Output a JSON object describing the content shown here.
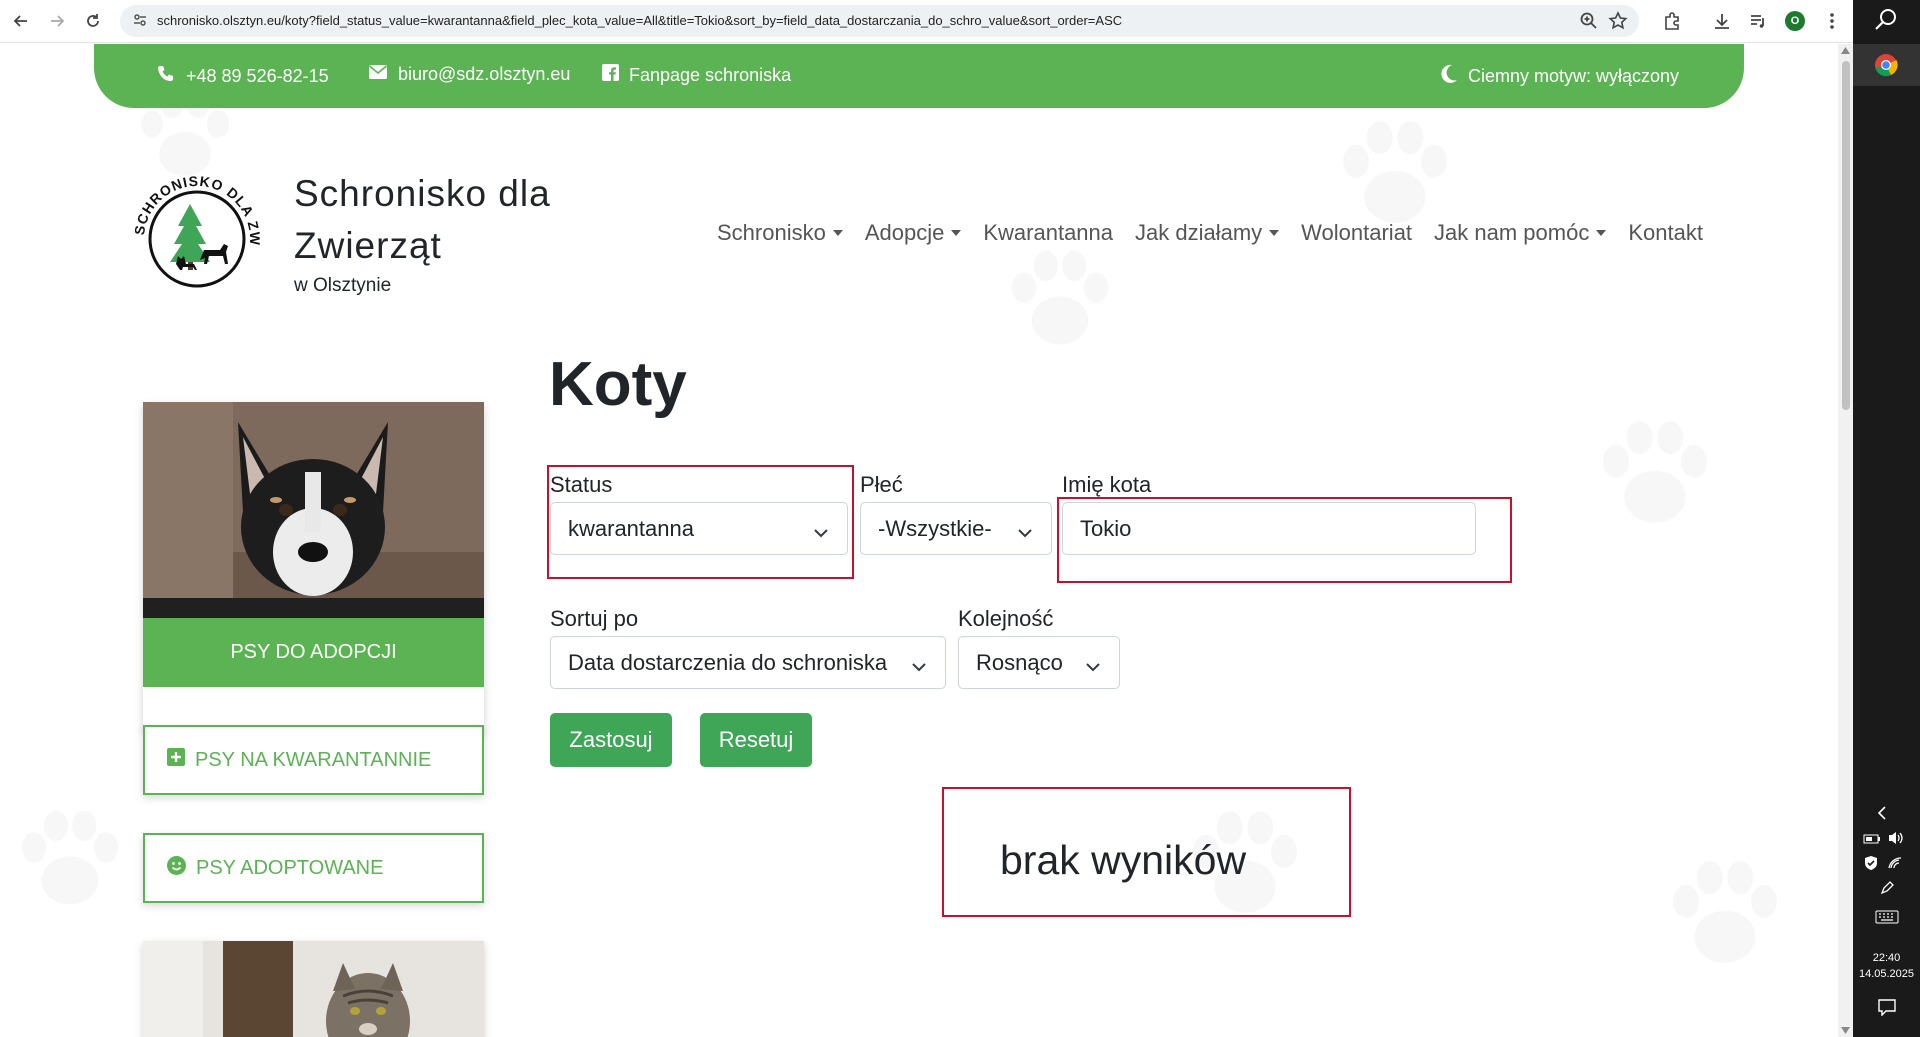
{
  "browser": {
    "url": "schronisko.olsztyn.eu/koty?field_status_value=kwarantanna&field_plec_kota_value=All&title=Tokio&sort_by=field_data_dostarczania_do_schro_value&sort_order=ASC",
    "profile_initial": "O"
  },
  "topbar": {
    "phone": "+48 89 526-82-15",
    "email": "biuro@sdz.olsztyn.eu",
    "fanpage": "Fanpage schroniska",
    "theme": "Ciemny motyw: wyłączony"
  },
  "header": {
    "title_line1": "Schronisko dla",
    "title_line2": "Zwierząt",
    "subtitle": "w Olsztynie",
    "logo_text": "SCHRONISKO DLA ZWIERZĄT W OLSZTYNIE"
  },
  "nav": [
    {
      "label": "Schronisko",
      "dropdown": true
    },
    {
      "label": "Adopcje",
      "dropdown": true
    },
    {
      "label": "Kwarantanna",
      "dropdown": false
    },
    {
      "label": "Jak działamy",
      "dropdown": true
    },
    {
      "label": "Wolontariat",
      "dropdown": false
    },
    {
      "label": "Jak nam pomóc",
      "dropdown": true
    },
    {
      "label": "Kontakt",
      "dropdown": false
    }
  ],
  "sidebar": {
    "card_caption": "PSY DO ADOPCJI",
    "btn_quarantine": "PSY NA KWARANTANNIE",
    "btn_adopted": "PSY ADOPTOWANE"
  },
  "main": {
    "heading": "Koty",
    "filters": {
      "status_label": "Status",
      "status_value": "kwarantanna",
      "sex_label": "Płeć",
      "sex_value": "-Wszystkie-",
      "name_label": "Imię kota",
      "name_value": "Tokio",
      "sort_label": "Sortuj po",
      "sort_value": "Data dostarczenia do schroniska",
      "order_label": "Kolejność",
      "order_value": "Rosnąco"
    },
    "apply_button": "Zastosuj",
    "reset_button": "Resetuj",
    "no_results": "brak wyników"
  },
  "taskbar": {
    "time": "22:40",
    "date": "14.05.2025"
  },
  "colors": {
    "brand_green": "#5cb354",
    "button_green": "#3ea656",
    "highlight_red": "#c8102e"
  }
}
